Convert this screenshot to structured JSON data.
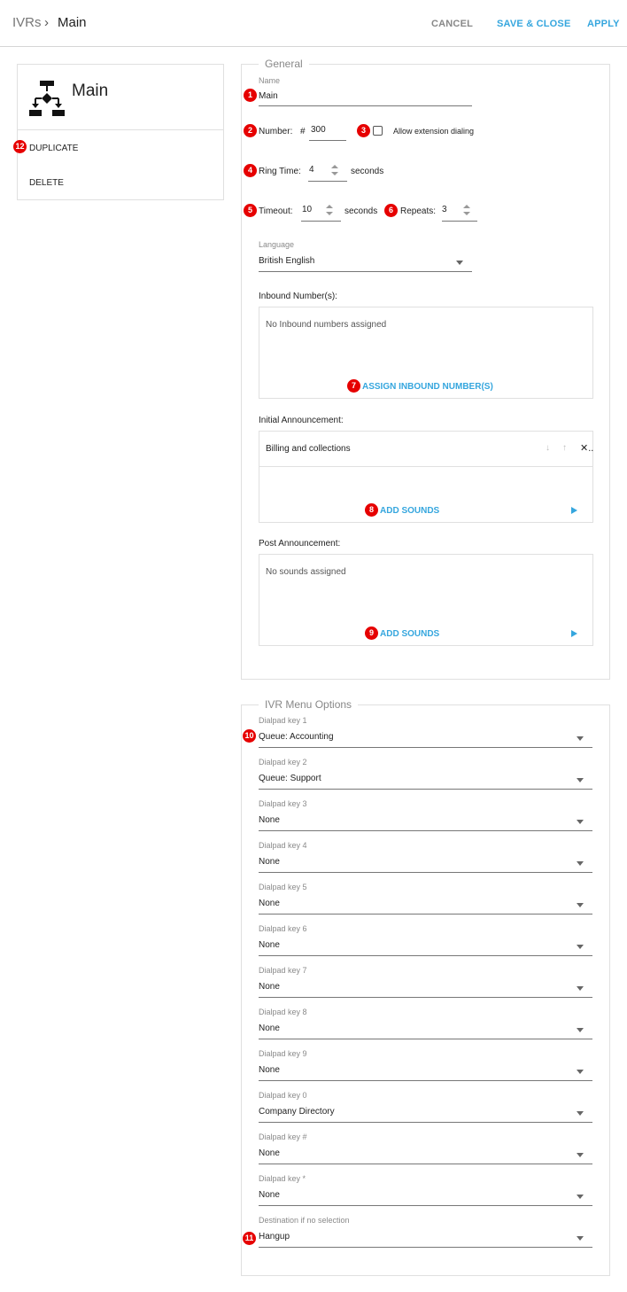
{
  "header": {
    "breadcrumb_root": "IVRs",
    "breadcrumb_separator": "›",
    "breadcrumb_current": "Main",
    "cancel_label": "CANCEL",
    "save_close_label": "SAVE & CLOSE",
    "apply_label": "APPLY"
  },
  "left_panel": {
    "title": "Main",
    "icon": "ivr-flow-icon",
    "duplicate_label": "DUPLICATE",
    "delete_label": "DELETE"
  },
  "general": {
    "legend": "General",
    "name_label": "Name",
    "name_value": "Main",
    "number_label": "Number:",
    "number_prefix": "#",
    "number_value": "300",
    "allow_extension_label": "Allow extension dialing",
    "allow_extension_checked": false,
    "ring_time_label": "Ring Time:",
    "ring_time_value": "4",
    "ring_time_unit": "seconds",
    "timeout_label": "Timeout:",
    "timeout_value": "10",
    "timeout_unit": "seconds",
    "repeats_label": "Repeats:",
    "repeats_value": "3",
    "language_label": "Language",
    "language_value": "British English",
    "inbound_label": "Inbound Number(s):",
    "inbound_empty": "No Inbound numbers assigned",
    "assign_inbound_label": "ASSIGN INBOUND NUMBER(S)",
    "initial_announcement_label": "Initial Announcement:",
    "initial_sounds": [
      "Billing and collections"
    ],
    "move_down_glyph": "↓",
    "move_up_glyph": "↑",
    "remove_glyph": "✕..",
    "add_sounds_label": "ADD SOUNDS",
    "post_announcement_label": "Post Announcement:",
    "post_empty": "No sounds assigned",
    "post_add_sounds_label": "ADD SOUNDS"
  },
  "menu": {
    "legend": "IVR Menu Options",
    "options": [
      {
        "label": "Dialpad key 1",
        "value": "Queue: Accounting"
      },
      {
        "label": "Dialpad key 2",
        "value": "Queue: Support"
      },
      {
        "label": "Dialpad key 3",
        "value": "None"
      },
      {
        "label": "Dialpad key 4",
        "value": "None"
      },
      {
        "label": "Dialpad key 5",
        "value": "None"
      },
      {
        "label": "Dialpad key 6",
        "value": "None"
      },
      {
        "label": "Dialpad key 7",
        "value": "None"
      },
      {
        "label": "Dialpad key 8",
        "value": "None"
      },
      {
        "label": "Dialpad key 9",
        "value": "None"
      },
      {
        "label": "Dialpad key 0",
        "value": "Company Directory"
      },
      {
        "label": "Dialpad key #",
        "value": "None"
      },
      {
        "label": "Dialpad key *",
        "value": "None"
      },
      {
        "label": "Destination if no selection",
        "value": "Hangup"
      }
    ]
  },
  "badges": [
    "1",
    "2",
    "3",
    "4",
    "5",
    "6",
    "7",
    "8",
    "9",
    "10",
    "11",
    "12"
  ],
  "colors": {
    "accent": "#35a6de",
    "badge": "#e60000",
    "border": "#e0e0e0"
  }
}
